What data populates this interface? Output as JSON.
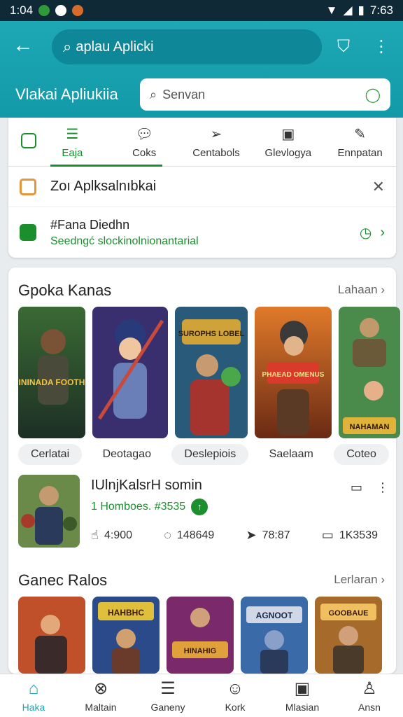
{
  "status": {
    "time_left": "1:04",
    "time_right": "7:63"
  },
  "header": {
    "search_text": "aplau Aplicki",
    "title": "Vlakai Apliukiia",
    "search2_placeholder": "Senvan"
  },
  "tabs": [
    {
      "label": "Eaja",
      "icon": "list-icon"
    },
    {
      "label": "Coks",
      "icon": "chat-icon"
    },
    {
      "label": "Centabols",
      "icon": "send-icon"
    },
    {
      "label": "Glevlogya",
      "icon": "calendar-icon"
    },
    {
      "label": "Ennpatan",
      "icon": "edit-icon"
    }
  ],
  "notice": {
    "text": "Zoı Aplksalnıbkai"
  },
  "promo": {
    "title": "#Fana Diedhn",
    "subtitle": "Seedngć slockinolnionantarial"
  },
  "section1": {
    "title": "Gpoka Kanas",
    "more": "Lahaan"
  },
  "chips": [
    "Cerlatai",
    "Deotagao",
    "Deslepiois",
    "Saelaam",
    "Coteo"
  ],
  "thumbs": [
    {
      "caption": "ININADA FOOTH"
    },
    {
      "caption": ""
    },
    {
      "caption": "SUROPHS LOBEL"
    },
    {
      "caption": "PHAEAD OMENUS"
    },
    {
      "caption": "NAHAMAN"
    }
  ],
  "app": {
    "name": "IUlnjKalsrH somin",
    "sub": "1 Homboes. #3535",
    "stats": [
      {
        "icon": "thumb-icon",
        "value": "4:900"
      },
      {
        "icon": "comment-icon",
        "value": "148649"
      },
      {
        "icon": "share-icon",
        "value": "78:87"
      },
      {
        "icon": "tv-icon",
        "value": "1K3539"
      }
    ]
  },
  "section2": {
    "title": "Ganec Ralos",
    "more": "Lerlaran"
  },
  "thumbs2": [
    {
      "caption": ""
    },
    {
      "caption": "HAHBHC"
    },
    {
      "caption": "HINAHIG"
    },
    {
      "caption": "AGNOOT"
    },
    {
      "caption": "GOOBAUE"
    }
  ],
  "nav": [
    {
      "label": "Haka",
      "icon": "home-icon"
    },
    {
      "label": "Maltain",
      "icon": "tools-icon"
    },
    {
      "label": "Ganeny",
      "icon": "list-icon"
    },
    {
      "label": "Kork",
      "icon": "smile-icon"
    },
    {
      "label": "Mlasian",
      "icon": "box-icon"
    },
    {
      "label": "Ansn",
      "icon": "person-icon"
    }
  ],
  "colors": {
    "accent": "#1ea7b4",
    "green": "#1b8f2e",
    "statusbar": "#0f2a36"
  }
}
